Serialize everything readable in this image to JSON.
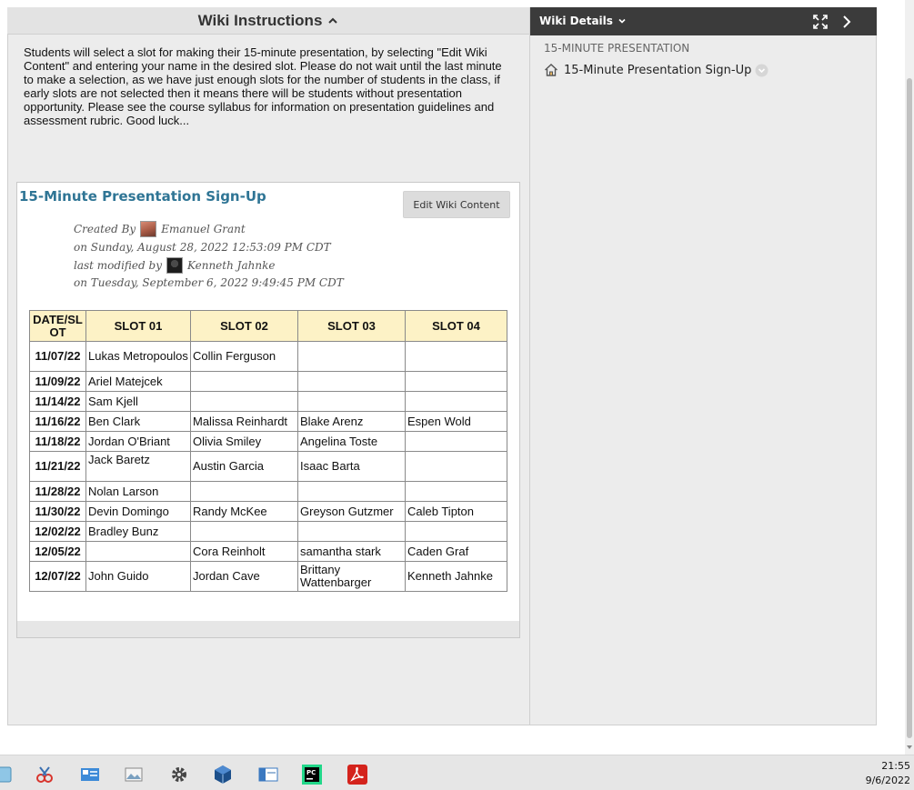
{
  "instructions": {
    "title": "Wiki Instructions",
    "caret_icon": "chevron-up-icon",
    "text": "Students will select a slot for making their 15-minute presentation, by selecting \"Edit Wiki Content\" and entering your name in the desired slot. Please do not wait until the last minute to make a selection, as we have just enough slots for the number of students in the class, if early slots are not selected then it means there will be students without presentation opportunity. Please see the course syllabus for information on presentation guidelines and assessment rubric. Good luck..."
  },
  "wiki_page": {
    "title": "15-Minute Presentation Sign-Up",
    "edit_button": "Edit Wiki Content",
    "created_by_label": "Created By",
    "created_by": "Emanuel Grant",
    "created_on": "on Sunday, August 28, 2022 12:53:09 PM CDT",
    "modified_by_label": "last modified by",
    "modified_by": "Kenneth Jahnke",
    "modified_on": "on Tuesday, September 6, 2022 9:49:45 PM CDT",
    "title_color": "#2f7595",
    "header_color": "#fdf2c6"
  },
  "table": {
    "headers": [
      "DATE/SL OT",
      "SLOT 01",
      "SLOT 02",
      "SLOT 03",
      "SLOT 04"
    ],
    "rows": [
      [
        "11/07/22",
        "Lukas Metropoulos",
        "Collin Ferguson",
        "",
        ""
      ],
      [
        "11/09/22",
        "Ariel Matejcek",
        "",
        "",
        ""
      ],
      [
        "11/14/22",
        "Sam Kjell",
        "",
        "",
        ""
      ],
      [
        "11/16/22",
        "Ben Clark",
        "Malissa Reinhardt",
        "Blake Arenz",
        "Espen Wold"
      ],
      [
        "11/18/22",
        "Jordan O'Briant",
        "Olivia Smiley",
        "Angelina Toste",
        ""
      ],
      [
        "11/21/22",
        "Jack Baretz",
        "Austin Garcia",
        "Isaac Barta",
        ""
      ],
      [
        "11/28/22",
        "Nolan Larson",
        "",
        "",
        ""
      ],
      [
        "11/30/22",
        "Devin Domingo",
        "Randy McKee",
        "Greyson Gutzmer",
        "Caleb Tipton"
      ],
      [
        "12/02/22",
        "Bradley Bunz",
        "",
        "",
        ""
      ],
      [
        "12/05/22",
        "",
        "Cora Reinholt",
        "samantha stark",
        "Caden Graf"
      ],
      [
        "12/07/22",
        "John Guido",
        "Jordan Cave",
        "Brittany Wattenbarger",
        "Kenneth Jahnke"
      ]
    ]
  },
  "details": {
    "title": "Wiki Details",
    "caret_icon": "chevron-down-icon",
    "expand_icon": "expand-icon",
    "next_icon": "chevron-right-icon",
    "section_label": "15-MINUTE PRESENTATION",
    "page_link": "15-Minute Presentation Sign-Up",
    "page_icon": "home-icon",
    "bar_color": "#3b3b3b"
  },
  "taskbar": {
    "time": "21:55",
    "date": "9/6/2022",
    "icons": [
      "app-icon",
      "snipping-tool-icon",
      "control-panel-icon",
      "image-viewer-icon",
      "settings-gear-icon",
      "virtualbox-icon",
      "window-manager-icon",
      "pycharm-icon",
      "acrobat-icon"
    ]
  }
}
